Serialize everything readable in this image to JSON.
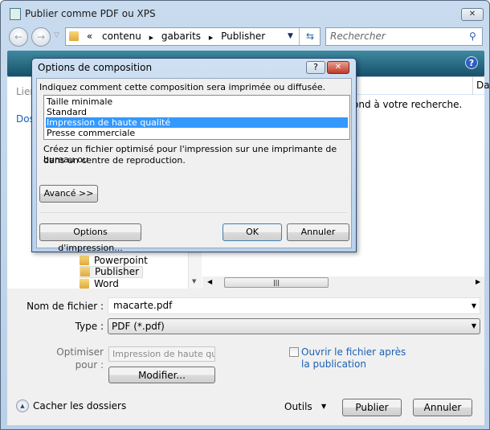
{
  "window": {
    "title": "Publier comme PDF ou XPS",
    "close": "✕"
  },
  "nav": {
    "back": "←",
    "forward": "→",
    "breadcrumb": [
      "«",
      "contenu",
      "gabarits",
      "Publisher"
    ],
    "search_placeholder": "Rechercher"
  },
  "left_pane": {
    "items": [
      "Lien",
      "Dos"
    ]
  },
  "tree": {
    "items": [
      "Powerpoint",
      "Publisher",
      "Word"
    ],
    "selected": "Publisher"
  },
  "list": {
    "column_header": "Da",
    "empty_message": "ond à votre recherche."
  },
  "bottom": {
    "filename_label": "Nom de fichier :",
    "filename_value": "macarte.pdf",
    "type_label": "Type :",
    "type_value": "PDF (*.pdf)",
    "optimize_label_1": "Optimiser",
    "optimize_label_2": "pour :",
    "optimize_value": "Impression de haute qua",
    "modify_button": "Modifier...",
    "open_after_label_1": "Ouvrir le fichier après",
    "open_after_label_2": "la publication",
    "open_after_checked": false,
    "hide_folders": "Cacher les dossiers",
    "tools": "Outils",
    "publish": "Publier",
    "cancel": "Annuler"
  },
  "dialog": {
    "title": "Options de composition",
    "help": "?",
    "close": "✕",
    "prompt": "Indiquez comment cette composition sera imprimée ou diffusée.",
    "options": [
      "Taille minimale",
      "Standard",
      "Impression de haute qualité",
      "Presse commerciale"
    ],
    "selected_index": 2,
    "description_1": "Créez un fichier optimisé pour l'impression sur une imprimante de bureau ou",
    "description_2": "dans un centre de reproduction.",
    "advanced": "Avancé >>",
    "print_options": "Options d'impression...",
    "ok": "OK",
    "cancel": "Annuler"
  },
  "colors": {
    "selection": "#3399ff",
    "link": "#1a5fb4",
    "toolbar": "#17506a"
  }
}
